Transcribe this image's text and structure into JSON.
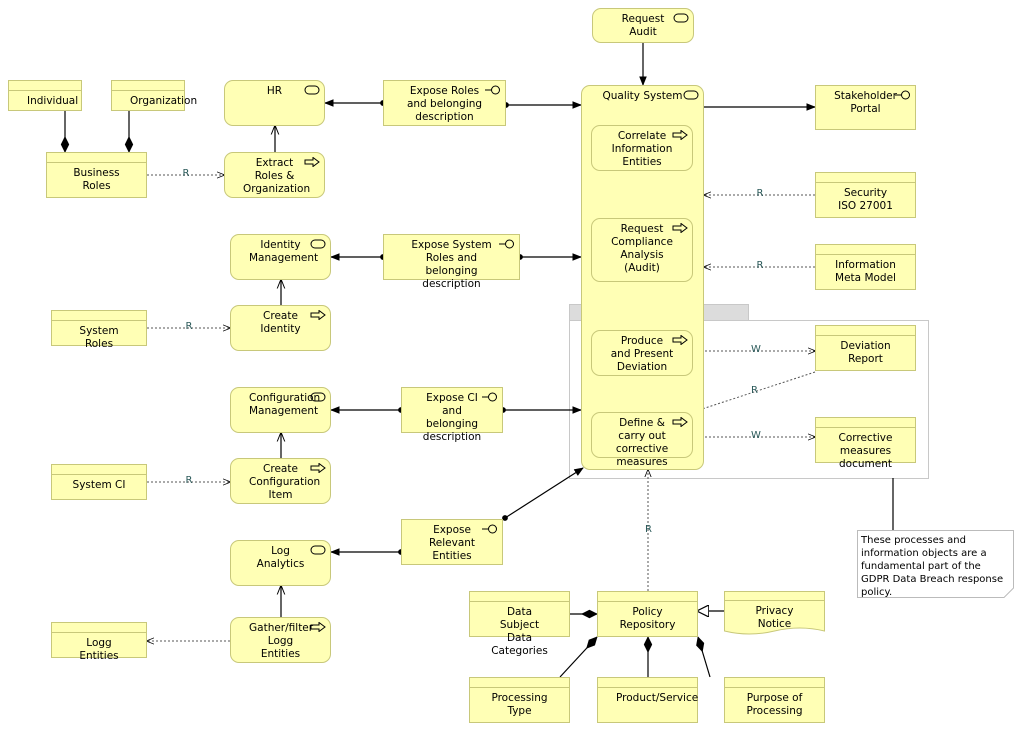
{
  "nodes": {
    "request_audit": "Request Audit",
    "individual": "Individual",
    "organization": "Organization",
    "business_roles": "Business Roles",
    "hr": "HR",
    "extract_roles": "Extract Roles & Organization",
    "expose_roles": "Expose Roles and belonging description",
    "quality_system": "Quality System",
    "correlate": "Correlate Information Entities",
    "request_compliance": "Request Compliance Analysis (Audit)",
    "produce_deviation": "Produce and Present Deviation",
    "define_corrective": "Define & carry out corrective measures",
    "stakeholder_portal": "Stakeholder Portal",
    "security_iso": "Security ISO 27001",
    "info_meta_model": "Information Meta Model",
    "deviation_report": "Deviation Report",
    "corrective_doc": "Corrective measures document",
    "identity_mgmt": "Identity Management",
    "expose_system_roles": "Expose System Roles and belonging description",
    "system_roles": "System Roles",
    "create_identity": "Create Identity",
    "config_mgmt": "Configuration Management",
    "expose_ci": "Expose CI and belonging description",
    "system_ci": "System CI",
    "create_config_item": "Create Configuration Item",
    "log_analytics": "Log Analytics",
    "expose_relevant": "Expose Relevant Entities",
    "logg_entities": "Logg Entities",
    "gather_filter": "Gather/filter Logg Entities",
    "data_subject": "Data Subject Data Categories",
    "policy_repo": "Policy Repository",
    "privacy_notice": "Privacy Notice",
    "processing_type": "Processing Type",
    "product_service": "Product/Service",
    "purpose_processing": "Purpose of Processing"
  },
  "note": "These processes and information objects are a fundamental part of the GDPR Data Breach response policy.",
  "relation_labels": {
    "read": "R",
    "write": "W"
  },
  "colors": {
    "element_fill": "#ffffb5",
    "element_border": "#c8c87a",
    "group_tab": "#dcdcdc",
    "edge": "#000000"
  }
}
